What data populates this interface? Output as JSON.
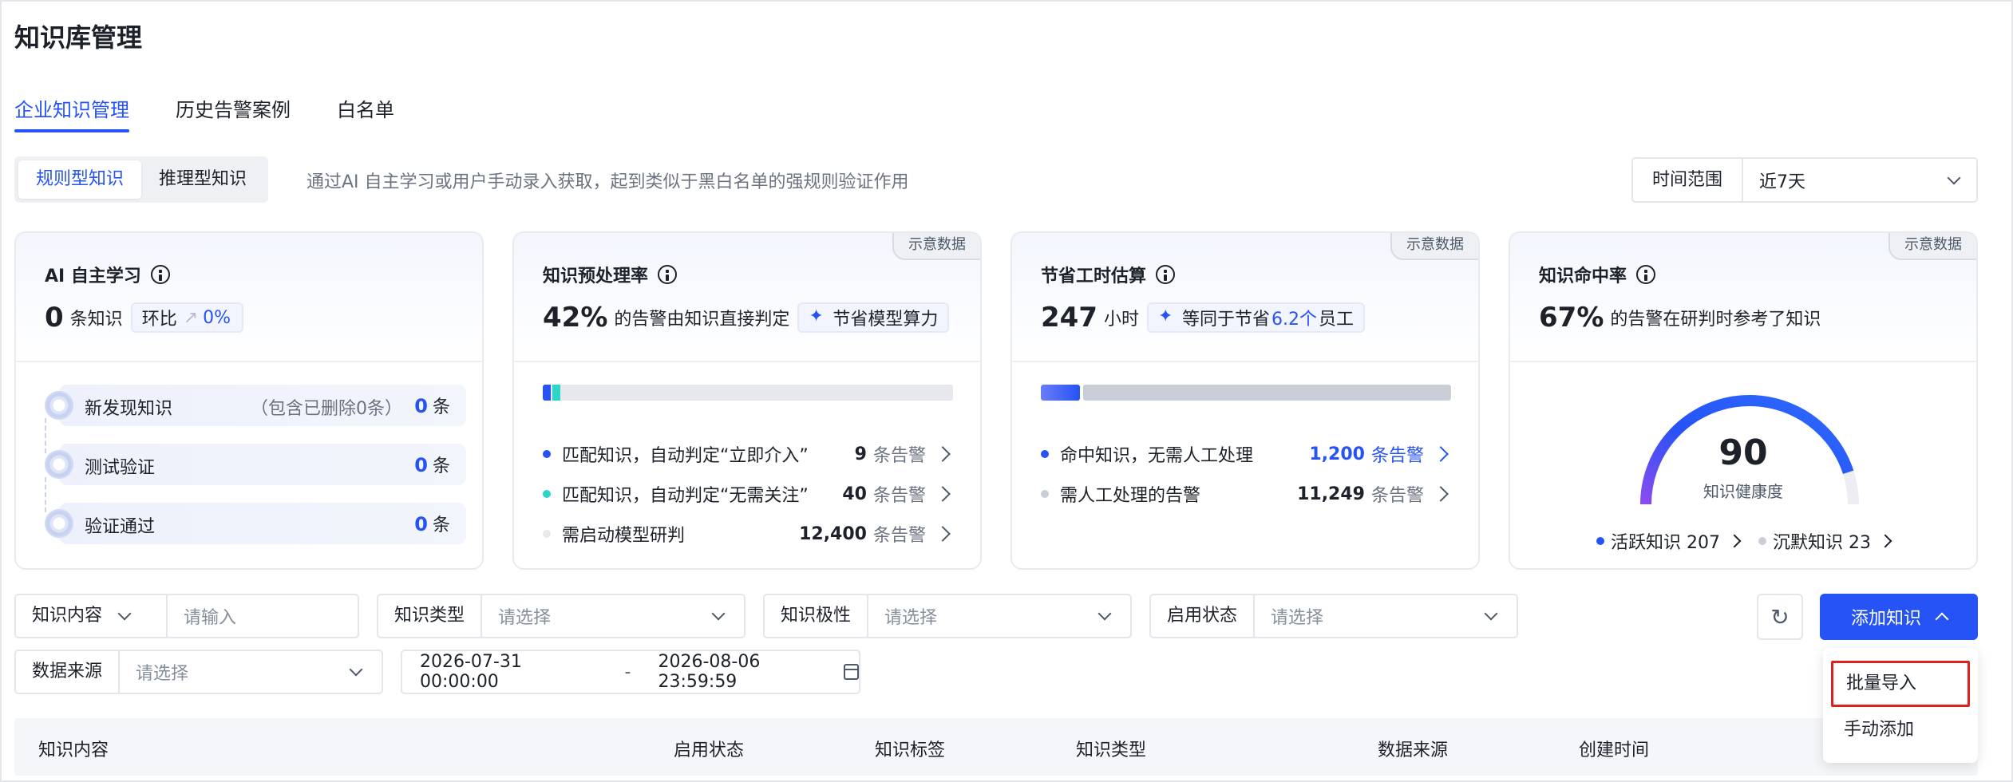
{
  "page": {
    "title": "知识库管理"
  },
  "tabs": [
    {
      "label": "企业知识管理",
      "active": true
    },
    {
      "label": "历史告警案例",
      "active": false
    },
    {
      "label": "白名单",
      "active": false
    }
  ],
  "segment": {
    "options": [
      "规则型知识",
      "推理型知识"
    ],
    "active": "规则型知识",
    "description": "通过AI 自主学习或用户手动录入获取，起到类似于黑白名单的强规则验证作用"
  },
  "time_range": {
    "label": "时间范围",
    "value": "近7天"
  },
  "cards": {
    "ai_learning": {
      "title": "AI 自主学习",
      "value": "0",
      "unit": "条知识",
      "compare_label": "环比",
      "compare_value": "0%",
      "steps": [
        {
          "label": "新发现知识",
          "note": "（包含已删除0条）",
          "count": "0",
          "unit": "条"
        },
        {
          "label": "测试验证",
          "note": "",
          "count": "0",
          "unit": "条"
        },
        {
          "label": "验证通过",
          "note": "",
          "count": "0",
          "unit": "条"
        }
      ]
    },
    "preprocess": {
      "title": "知识预处理率",
      "badge": "示意数据",
      "value": "42%",
      "desc": "的告警由知识直接判定",
      "pill": "节省模型算力",
      "rows": [
        {
          "label": "匹配知识，自动判定“立即介入”",
          "value": "9",
          "unit": "条告警",
          "color": "#2553f6",
          "count": 9
        },
        {
          "label": "匹配知识，自动判定“无需关注”",
          "value": "40",
          "unit": "条告警",
          "color": "#2dd4c8",
          "count": 40
        },
        {
          "label": "需启动模型研判",
          "value": "12,400",
          "unit": "条告警",
          "color": "#e6e8ee",
          "count": 12400
        }
      ]
    },
    "savings": {
      "title": "节省工时估算",
      "badge": "示意数据",
      "value": "247",
      "unit": "小时",
      "pill_prefix": "等同于节省",
      "pill_value": "6.2个",
      "pill_suffix": "员工",
      "rows": [
        {
          "label": "命中知识，无需人工处理",
          "value": "1,200",
          "unit": "条告警",
          "color": "#2553f6",
          "count": 1200,
          "highlight": true
        },
        {
          "label": "需人工处理的告警",
          "value": "11,249",
          "unit": "条告警",
          "color": "#c9cdd6",
          "count": 11249,
          "highlight": false
        }
      ]
    },
    "hit_rate": {
      "title": "知识命中率",
      "badge": "示意数据",
      "value": "67%",
      "desc": "的告警在研判时参考了知识",
      "gauge_value": "90",
      "gauge_fraction": 0.9,
      "gauge_label": "知识健康度",
      "legend": [
        {
          "label": "活跃知识 207",
          "color": "#2553f6"
        },
        {
          "label": "沉默知识 23",
          "color": "#c9cdd6"
        }
      ]
    }
  },
  "filters": {
    "content": {
      "label": "知识内容",
      "placeholder": "请输入"
    },
    "type": {
      "label": "知识类型",
      "placeholder": "请选择"
    },
    "polarity": {
      "label": "知识极性",
      "placeholder": "请选择"
    },
    "status": {
      "label": "启用状态",
      "placeholder": "请选择"
    },
    "source": {
      "label": "数据来源",
      "placeholder": "请选择"
    },
    "date_start": "2026-07-31 00:00:00",
    "date_sep": "-",
    "date_end": "2026-08-06 23:59:59"
  },
  "actions": {
    "add_label": "添加知识",
    "dropdown": [
      "批量导入",
      "手动添加"
    ]
  },
  "table": {
    "headers": [
      "知识内容",
      "启用状态",
      "知识标签",
      "知识类型",
      "数据来源",
      "创建时间"
    ]
  },
  "colors": {
    "primary": "#2553f6",
    "teal": "#2dd4c8",
    "highlight_border": "#e02020"
  }
}
